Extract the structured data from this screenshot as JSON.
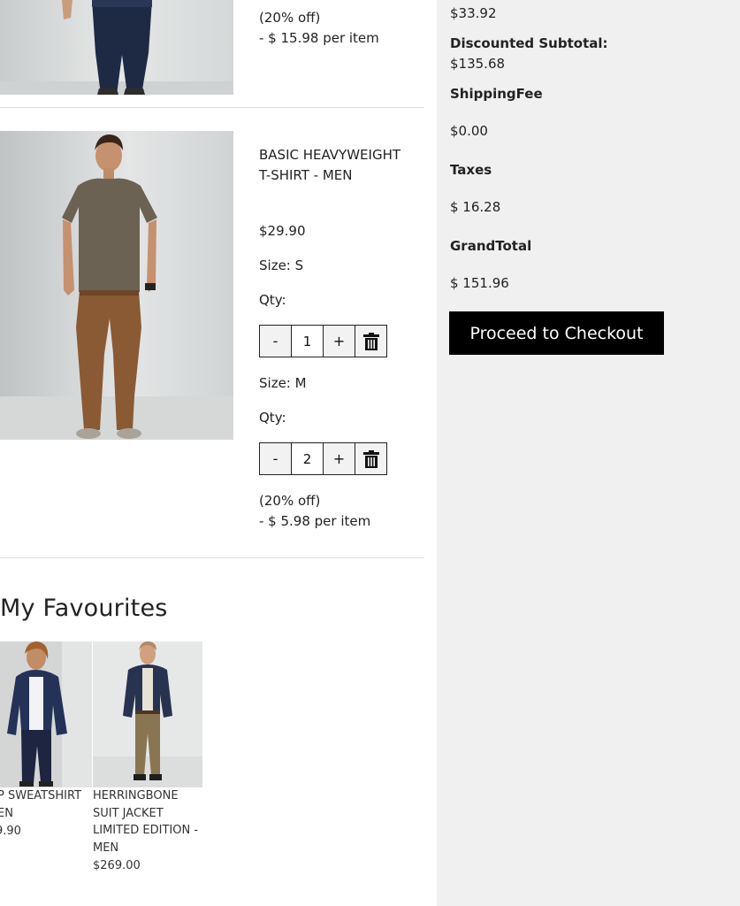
{
  "cart": {
    "item1_tail": {
      "discount_note": "(20% off)",
      "discount_amount": "- $ 15.98 per item"
    },
    "item2": {
      "name": "BASIC HEAVYWEIGHT T-SHIRT - MEN",
      "price": "$29.90",
      "variants": [
        {
          "size_label": "Size: S",
          "qty_label": "Qty:",
          "minus": "-",
          "qty": "1",
          "plus": "+"
        },
        {
          "size_label": "Size: M",
          "qty_label": "Qty:",
          "minus": "-",
          "qty": "2",
          "plus": "+"
        }
      ],
      "discount_note": "(20% off)",
      "discount_amount": "- $ 5.98 per item"
    }
  },
  "favourites": {
    "title": "My Favourites",
    "items": [
      {
        "name": "P SWEATSHIRT EN",
        "price": "9.90"
      },
      {
        "name": "HERRINGBONE SUIT JACKET LIMITED EDITION - MEN",
        "price": "$269.00"
      }
    ]
  },
  "summary": {
    "discount_value": "$33.92",
    "discounted_subtotal_label": "Discounted Subtotal:",
    "discounted_subtotal_value": "$135.68",
    "shipping_label": "ShippingFee",
    "shipping_value": "$0.00",
    "taxes_label": "Taxes",
    "taxes_value": "$ 16.28",
    "grand_total_label": "GrandTotal",
    "grand_total_value": "$ 151.96",
    "checkout_label": "Proceed to Checkout"
  },
  "icons": {
    "trash": "trash-icon"
  }
}
